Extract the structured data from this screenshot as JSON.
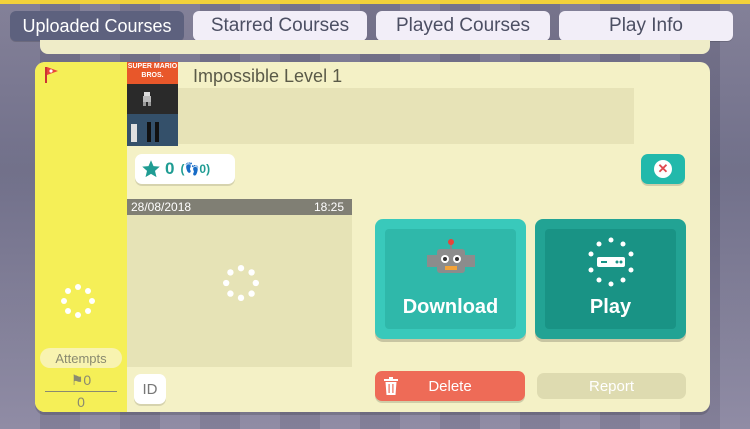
{
  "tabs": [
    {
      "label": "Uploaded Courses"
    },
    {
      "label": "Starred Courses"
    },
    {
      "label": "Played Courses"
    },
    {
      "label": "Play Info"
    }
  ],
  "course": {
    "thumbnail_logo": "SUPER MARIO BROS.",
    "title": "Impossible Level 1",
    "stars": "0",
    "footprints": "0",
    "date": "28/08/2018",
    "time": "18:25"
  },
  "attempts": {
    "label": "Attempts",
    "cleared": "0",
    "total": "0"
  },
  "buttons": {
    "id": "ID",
    "download": "Download",
    "play": "Play",
    "delete": "Delete",
    "report": "Report"
  },
  "icons": {
    "flag": "flag-icon",
    "star": "star-icon",
    "footprints": "footprints-icon",
    "close": "close-icon",
    "download": "robot-icon",
    "play": "controller-icon",
    "delete": "trash-icon",
    "loading": "loading-spinner-icon"
  },
  "colors": {
    "accent": "#22b9ab",
    "delete": "#ee6b57",
    "card": "#f4f1c6",
    "side": "#f5ef57"
  }
}
